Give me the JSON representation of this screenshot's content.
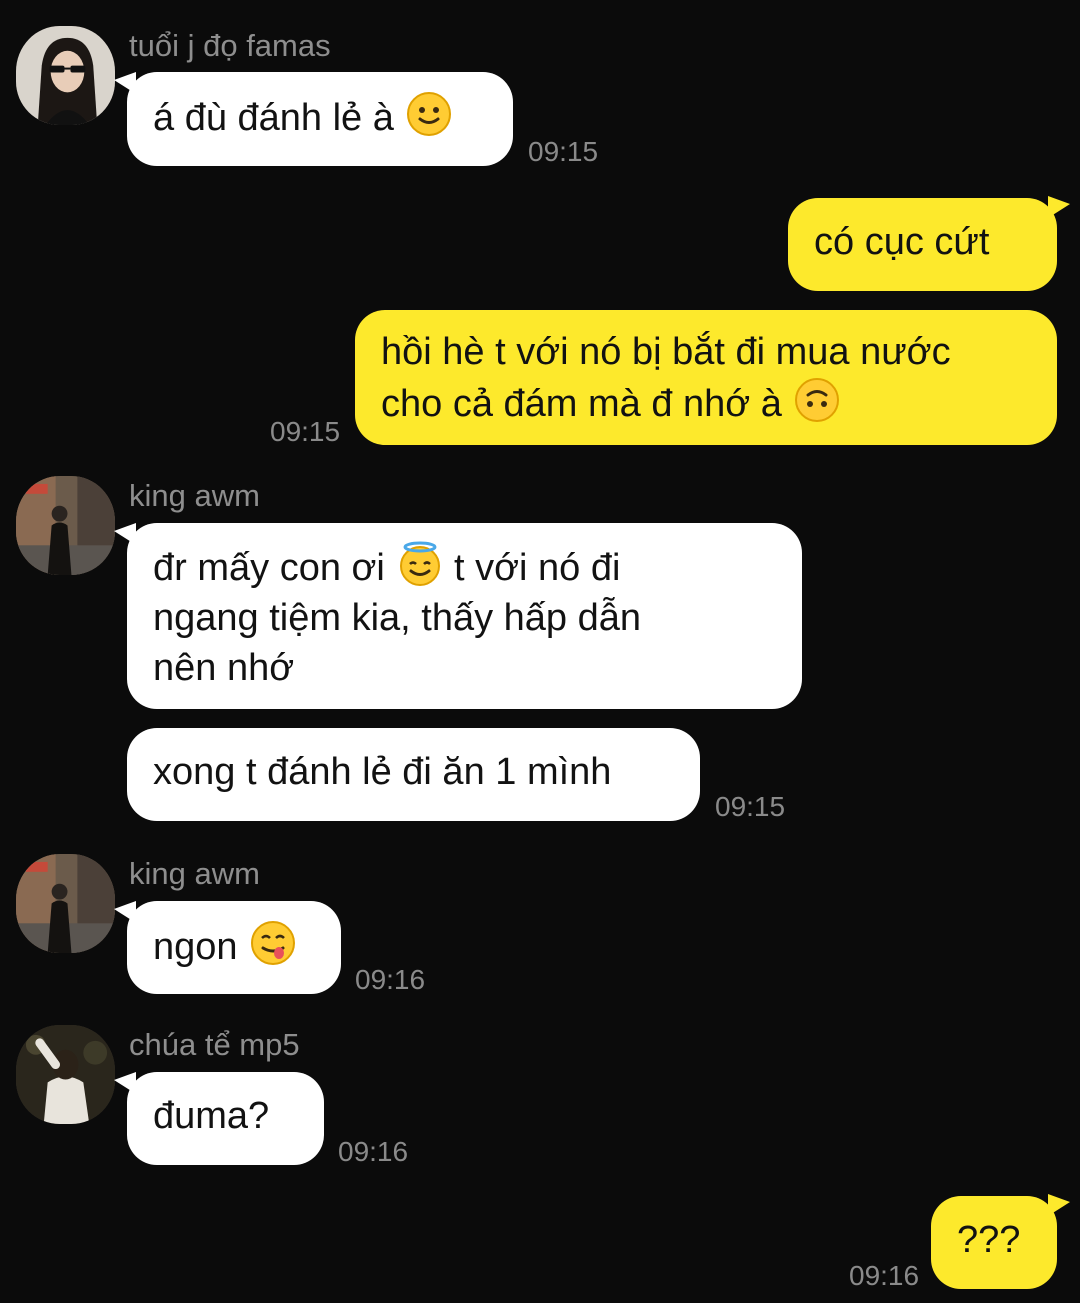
{
  "messages": [
    {
      "sender": "tuổi j đọ famas",
      "text": "á đù đánh lẻ à",
      "emoji": "slightly-smiling-face",
      "time": "09:15"
    },
    {
      "text": "có cục cứt"
    },
    {
      "text_line1": "hồi hè t với nó bị bắt đi mua nước",
      "text_line2": "cho cả đám mà đ nhớ à",
      "emoji": "upside-down-face",
      "time": "09:15"
    },
    {
      "sender": "king awm",
      "text_part1": "đr mấy con ơi",
      "emoji": "smiling-face-with-halo",
      "text_part2": "t với nó đi",
      "text_line2": "ngang tiệm kia, thấy hấp dẫn",
      "text_line3": "nên nhớ"
    },
    {
      "text": "xong t đánh lẻ đi ăn 1 mình",
      "time": "09:15"
    },
    {
      "sender": "king awm",
      "text": "ngon",
      "emoji": "face-savoring-food",
      "time": "09:16"
    },
    {
      "sender": "chúa tể mp5",
      "text": "đuma?",
      "time": "09:16"
    },
    {
      "text": "???",
      "time": "09:16"
    }
  ],
  "colors": {
    "background": "#0b0b0b",
    "incoming_bubble": "#ffffff",
    "outgoing_bubble": "#fde92c",
    "meta_text": "#8e8e8e"
  }
}
